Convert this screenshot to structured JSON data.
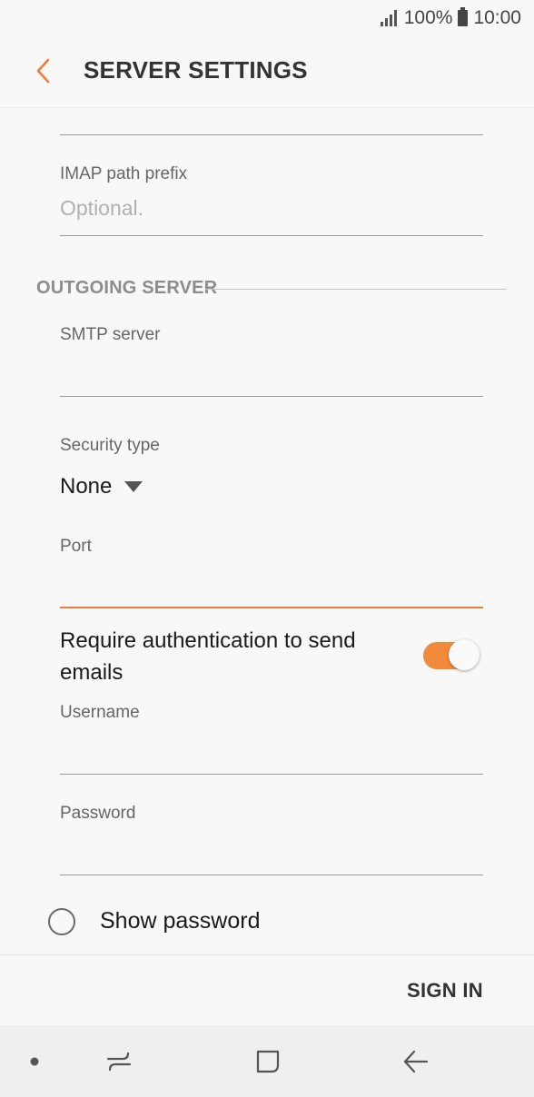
{
  "status_bar": {
    "battery_percent": "100%",
    "time": "10:00"
  },
  "header": {
    "title": "SERVER SETTINGS"
  },
  "fields": {
    "imap_prefix": {
      "label": "IMAP path prefix",
      "placeholder": "Optional."
    },
    "outgoing_section": "OUTGOING SERVER",
    "smtp_server": {
      "label": "SMTP server",
      "value": ""
    },
    "security_type": {
      "label": "Security type",
      "value": "None"
    },
    "port": {
      "label": "Port",
      "value": ""
    },
    "require_auth": {
      "label": "Require authentication to send emails",
      "enabled": true
    },
    "username": {
      "label": "Username",
      "value": ""
    },
    "password": {
      "label": "Password",
      "value": ""
    },
    "show_password": {
      "label": "Show password",
      "checked": false
    }
  },
  "footer": {
    "sign_in_label": "SIGN IN"
  },
  "icons": {
    "back": "chevron-left-icon",
    "dropdown": "caret-down-icon",
    "nav_dot": "dot-icon",
    "nav_recents": "recents-icon",
    "nav_home": "home-icon",
    "nav_back": "back-arrow-icon"
  },
  "colors": {
    "accent": "#ef7d3c",
    "toggle_on": "#f28a3c"
  }
}
